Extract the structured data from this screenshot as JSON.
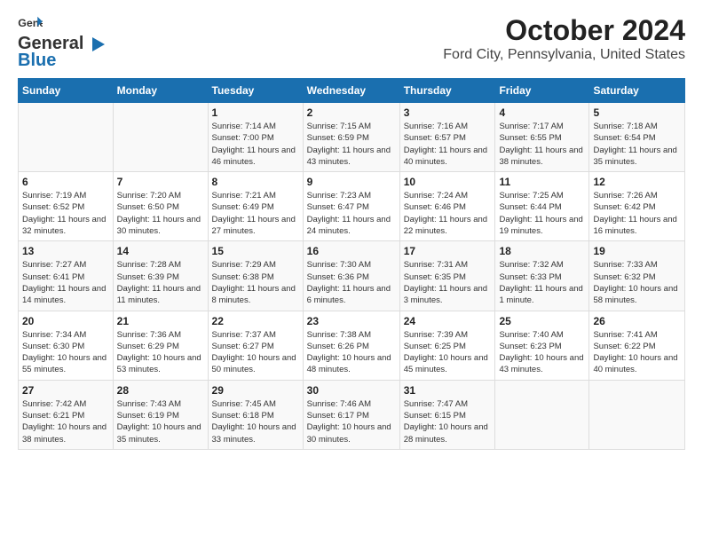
{
  "header": {
    "logo_general": "General",
    "logo_blue": "Blue",
    "month": "October 2024",
    "location": "Ford City, Pennsylvania, United States"
  },
  "days_of_week": [
    "Sunday",
    "Monday",
    "Tuesday",
    "Wednesday",
    "Thursday",
    "Friday",
    "Saturday"
  ],
  "weeks": [
    [
      {
        "day": "",
        "info": ""
      },
      {
        "day": "",
        "info": ""
      },
      {
        "day": "1",
        "sunrise": "7:14 AM",
        "sunset": "7:00 PM",
        "daylight": "11 hours and 46 minutes."
      },
      {
        "day": "2",
        "sunrise": "7:15 AM",
        "sunset": "6:59 PM",
        "daylight": "11 hours and 43 minutes."
      },
      {
        "day": "3",
        "sunrise": "7:16 AM",
        "sunset": "6:57 PM",
        "daylight": "11 hours and 40 minutes."
      },
      {
        "day": "4",
        "sunrise": "7:17 AM",
        "sunset": "6:55 PM",
        "daylight": "11 hours and 38 minutes."
      },
      {
        "day": "5",
        "sunrise": "7:18 AM",
        "sunset": "6:54 PM",
        "daylight": "11 hours and 35 minutes."
      }
    ],
    [
      {
        "day": "6",
        "sunrise": "7:19 AM",
        "sunset": "6:52 PM",
        "daylight": "11 hours and 32 minutes."
      },
      {
        "day": "7",
        "sunrise": "7:20 AM",
        "sunset": "6:50 PM",
        "daylight": "11 hours and 30 minutes."
      },
      {
        "day": "8",
        "sunrise": "7:21 AM",
        "sunset": "6:49 PM",
        "daylight": "11 hours and 27 minutes."
      },
      {
        "day": "9",
        "sunrise": "7:23 AM",
        "sunset": "6:47 PM",
        "daylight": "11 hours and 24 minutes."
      },
      {
        "day": "10",
        "sunrise": "7:24 AM",
        "sunset": "6:46 PM",
        "daylight": "11 hours and 22 minutes."
      },
      {
        "day": "11",
        "sunrise": "7:25 AM",
        "sunset": "6:44 PM",
        "daylight": "11 hours and 19 minutes."
      },
      {
        "day": "12",
        "sunrise": "7:26 AM",
        "sunset": "6:42 PM",
        "daylight": "11 hours and 16 minutes."
      }
    ],
    [
      {
        "day": "13",
        "sunrise": "7:27 AM",
        "sunset": "6:41 PM",
        "daylight": "11 hours and 14 minutes."
      },
      {
        "day": "14",
        "sunrise": "7:28 AM",
        "sunset": "6:39 PM",
        "daylight": "11 hours and 11 minutes."
      },
      {
        "day": "15",
        "sunrise": "7:29 AM",
        "sunset": "6:38 PM",
        "daylight": "11 hours and 8 minutes."
      },
      {
        "day": "16",
        "sunrise": "7:30 AM",
        "sunset": "6:36 PM",
        "daylight": "11 hours and 6 minutes."
      },
      {
        "day": "17",
        "sunrise": "7:31 AM",
        "sunset": "6:35 PM",
        "daylight": "11 hours and 3 minutes."
      },
      {
        "day": "18",
        "sunrise": "7:32 AM",
        "sunset": "6:33 PM",
        "daylight": "11 hours and 1 minute."
      },
      {
        "day": "19",
        "sunrise": "7:33 AM",
        "sunset": "6:32 PM",
        "daylight": "10 hours and 58 minutes."
      }
    ],
    [
      {
        "day": "20",
        "sunrise": "7:34 AM",
        "sunset": "6:30 PM",
        "daylight": "10 hours and 55 minutes."
      },
      {
        "day": "21",
        "sunrise": "7:36 AM",
        "sunset": "6:29 PM",
        "daylight": "10 hours and 53 minutes."
      },
      {
        "day": "22",
        "sunrise": "7:37 AM",
        "sunset": "6:27 PM",
        "daylight": "10 hours and 50 minutes."
      },
      {
        "day": "23",
        "sunrise": "7:38 AM",
        "sunset": "6:26 PM",
        "daylight": "10 hours and 48 minutes."
      },
      {
        "day": "24",
        "sunrise": "7:39 AM",
        "sunset": "6:25 PM",
        "daylight": "10 hours and 45 minutes."
      },
      {
        "day": "25",
        "sunrise": "7:40 AM",
        "sunset": "6:23 PM",
        "daylight": "10 hours and 43 minutes."
      },
      {
        "day": "26",
        "sunrise": "7:41 AM",
        "sunset": "6:22 PM",
        "daylight": "10 hours and 40 minutes."
      }
    ],
    [
      {
        "day": "27",
        "sunrise": "7:42 AM",
        "sunset": "6:21 PM",
        "daylight": "10 hours and 38 minutes."
      },
      {
        "day": "28",
        "sunrise": "7:43 AM",
        "sunset": "6:19 PM",
        "daylight": "10 hours and 35 minutes."
      },
      {
        "day": "29",
        "sunrise": "7:45 AM",
        "sunset": "6:18 PM",
        "daylight": "10 hours and 33 minutes."
      },
      {
        "day": "30",
        "sunrise": "7:46 AM",
        "sunset": "6:17 PM",
        "daylight": "10 hours and 30 minutes."
      },
      {
        "day": "31",
        "sunrise": "7:47 AM",
        "sunset": "6:15 PM",
        "daylight": "10 hours and 28 minutes."
      },
      {
        "day": "",
        "info": ""
      },
      {
        "day": "",
        "info": ""
      }
    ]
  ]
}
